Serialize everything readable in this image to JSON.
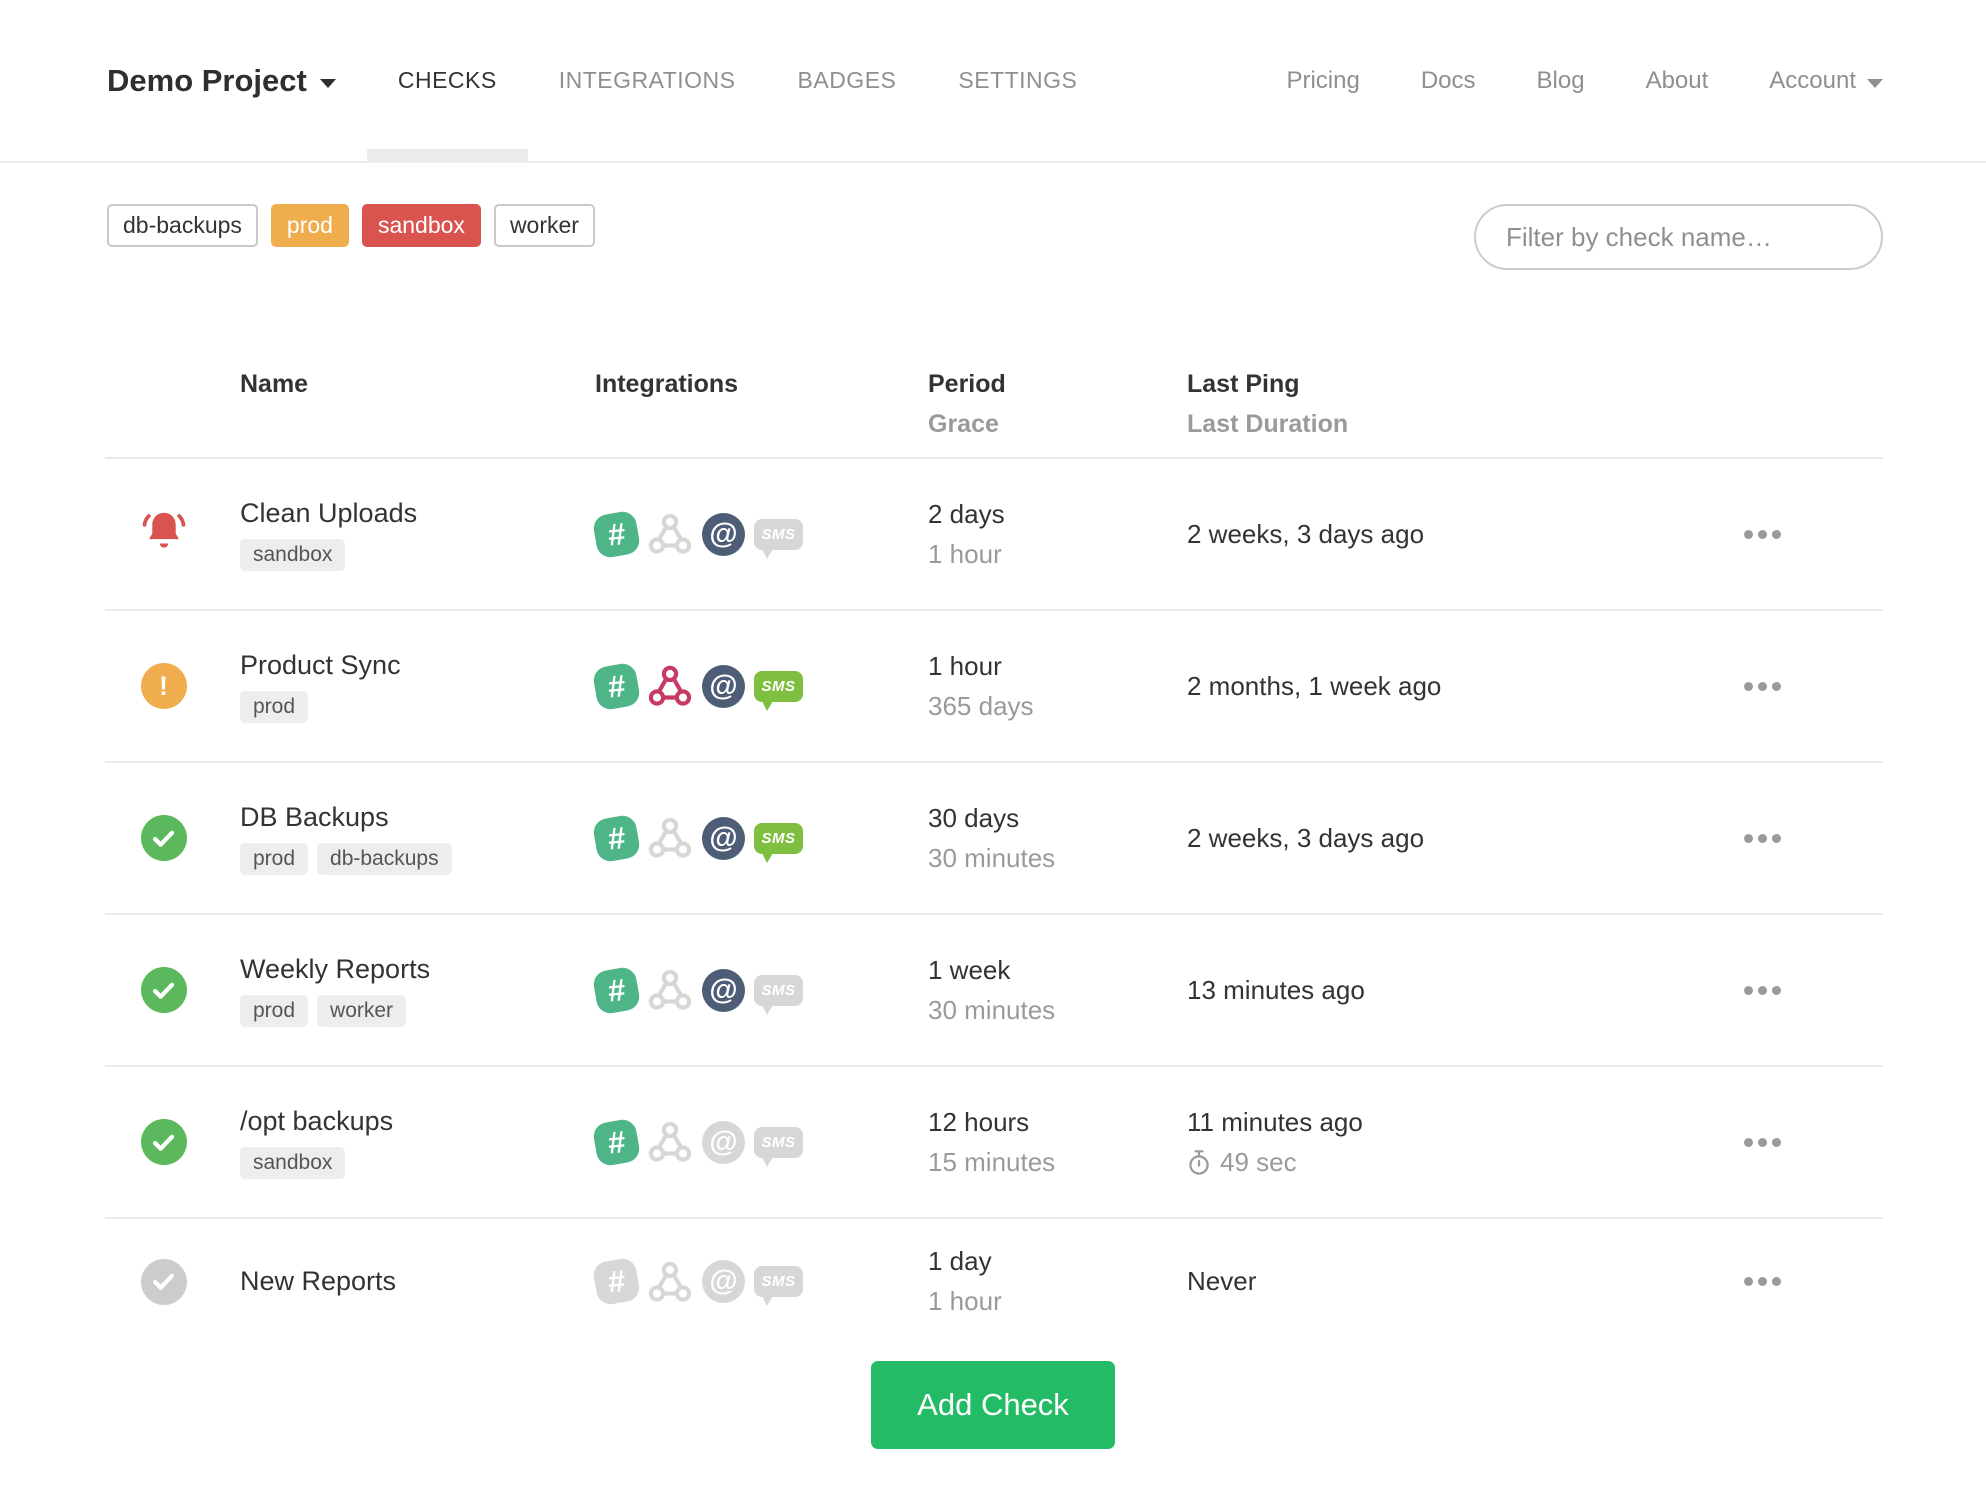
{
  "nav": {
    "project_name": "Demo Project",
    "tabs": [
      {
        "label": "CHECKS",
        "active": true
      },
      {
        "label": "INTEGRATIONS",
        "active": false
      },
      {
        "label": "BADGES",
        "active": false
      },
      {
        "label": "SETTINGS",
        "active": false
      }
    ],
    "links": [
      "Pricing",
      "Docs",
      "Blog",
      "About"
    ],
    "account_label": "Account"
  },
  "filter_bar": {
    "tags": [
      {
        "label": "db-backups",
        "style": "outline"
      },
      {
        "label": "prod",
        "style": "warning"
      },
      {
        "label": "sandbox",
        "style": "danger"
      },
      {
        "label": "worker",
        "style": "outline"
      }
    ],
    "search_placeholder": "Filter by check name…"
  },
  "table": {
    "headers": {
      "name": "Name",
      "integrations": "Integrations",
      "period": "Period",
      "grace": "Grace",
      "last_ping": "Last Ping",
      "last_duration": "Last Duration"
    },
    "rows": [
      {
        "status": "alert",
        "name": "Clean Uploads",
        "tags": [
          "sandbox"
        ],
        "integrations": {
          "slack": true,
          "webhook": false,
          "email": true,
          "sms": false
        },
        "period": "2 days",
        "grace": "1 hour",
        "last_ping": "2 weeks, 3 days ago",
        "last_duration": ""
      },
      {
        "status": "warning",
        "name": "Product Sync",
        "tags": [
          "prod"
        ],
        "integrations": {
          "slack": true,
          "webhook": true,
          "email": true,
          "sms": true
        },
        "period": "1 hour",
        "grace": "365 days",
        "last_ping": "2 months, 1 week ago",
        "last_duration": ""
      },
      {
        "status": "ok",
        "name": "DB Backups",
        "tags": [
          "prod",
          "db-backups"
        ],
        "integrations": {
          "slack": true,
          "webhook": false,
          "email": true,
          "sms": true
        },
        "period": "30 days",
        "grace": "30 minutes",
        "last_ping": "2 weeks, 3 days ago",
        "last_duration": ""
      },
      {
        "status": "ok",
        "name": "Weekly Reports",
        "tags": [
          "prod",
          "worker"
        ],
        "integrations": {
          "slack": true,
          "webhook": false,
          "email": true,
          "sms": false
        },
        "period": "1 week",
        "grace": "30 minutes",
        "last_ping": "13 minutes ago",
        "last_duration": ""
      },
      {
        "status": "ok",
        "name": "/opt backups",
        "tags": [
          "sandbox"
        ],
        "integrations": {
          "slack": true,
          "webhook": false,
          "email": false,
          "sms": false
        },
        "period": "12 hours",
        "grace": "15 minutes",
        "last_ping": "11 minutes ago",
        "last_duration": "49 sec"
      },
      {
        "status": "new",
        "name": "New Reports",
        "tags": [],
        "integrations": {
          "slack": false,
          "webhook": false,
          "email": false,
          "sms": false
        },
        "period": "1 day",
        "grace": "1 hour",
        "last_ping": "Never",
        "last_duration": ""
      }
    ]
  },
  "add_check_label": "Add Check",
  "colors": {
    "danger": "#d9534f",
    "warning": "#f0ad4e",
    "success": "#5cb85c",
    "new": "#cccccc",
    "slack": "#4eb588",
    "webhook": "#c73a63",
    "email": "#4c5d75",
    "sms": "#7fbf3f",
    "inactive": "#d7d7d7",
    "button": "#23bb66"
  }
}
